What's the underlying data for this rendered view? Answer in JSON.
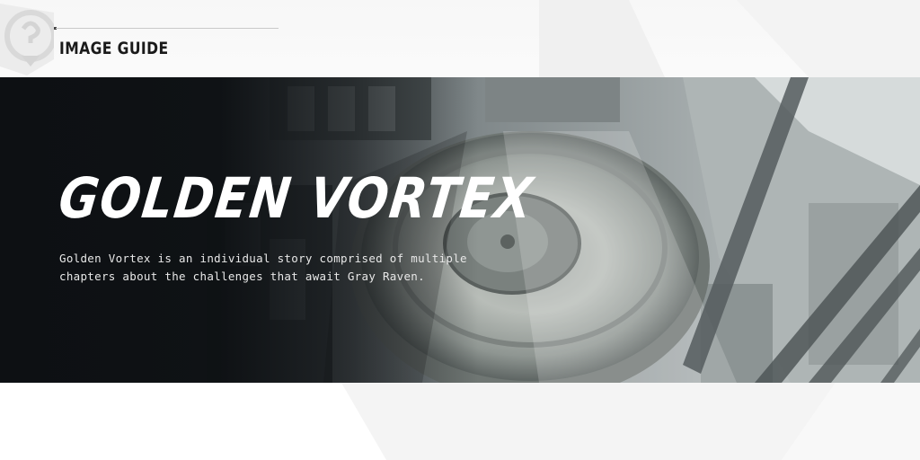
{
  "header": {
    "title": "IMAGE GUIDE",
    "icon": "question-hint-icon"
  },
  "banner": {
    "title": "GOLDEN VORTEX",
    "description_lines": [
      "Golden Vortex is an individual story comprised of multiple",
      "chapters about the challenges that await Gray Raven."
    ],
    "background": "ruined-arena-artwork"
  },
  "colors": {
    "banner_dark": "#0e1114",
    "title_text": "#1a1a1a",
    "banner_text": "#ffffff"
  }
}
